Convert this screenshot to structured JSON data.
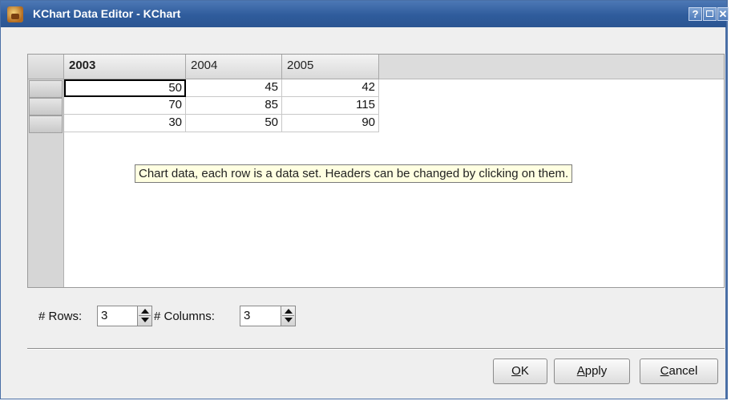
{
  "window": {
    "title": "KChart Data Editor - KChart",
    "help_label": "?",
    "close_label": "✕"
  },
  "table": {
    "column_headers": [
      "2003",
      "2004",
      "2005"
    ],
    "rows": [
      [
        "50",
        "45",
        "42"
      ],
      [
        "70",
        "85",
        "115"
      ],
      [
        "30",
        "50",
        "90"
      ]
    ],
    "selected_header": "2003",
    "current_cell": [
      0,
      0
    ]
  },
  "tooltip": "Chart data, each row is a data set. Headers can be changed by clicking on them.",
  "controls": {
    "rows_label": "# Rows:",
    "rows_value": "3",
    "columns_label": "# Columns:",
    "columns_value": "3"
  },
  "buttons": {
    "ok": "OK",
    "apply": "Apply",
    "cancel": "Cancel"
  },
  "mnemonics": {
    "ok": "O",
    "apply": "A",
    "cancel": "C"
  },
  "icons": [
    "kchart-app-icon",
    "help-icon",
    "maximize-icon",
    "close-icon",
    "spin-up-icon",
    "spin-down-icon"
  ]
}
